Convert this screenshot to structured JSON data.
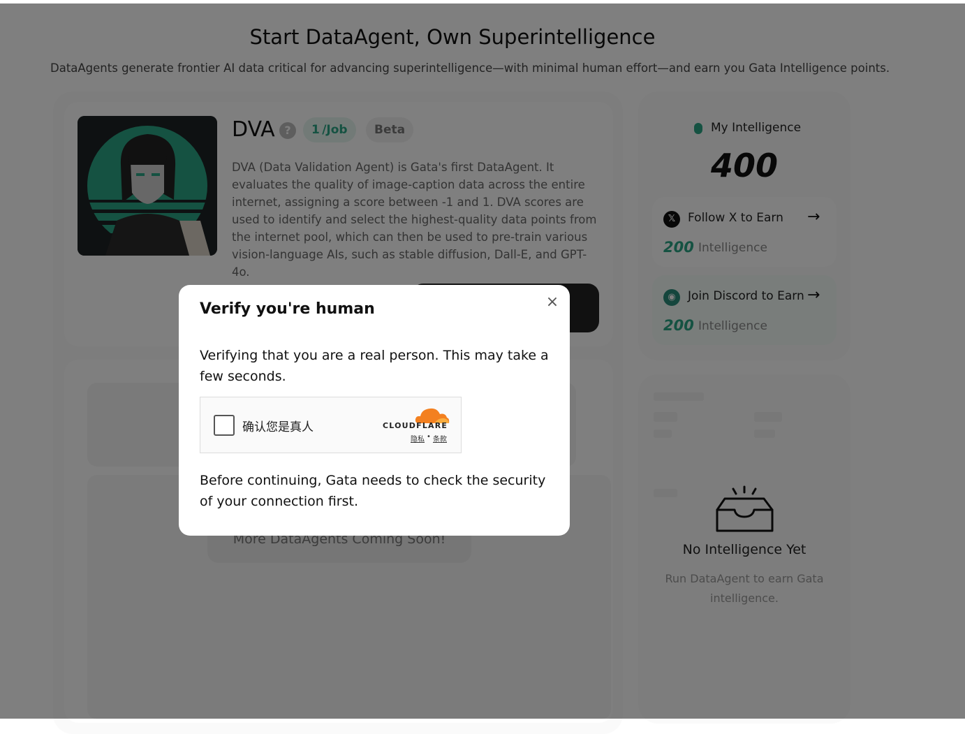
{
  "header": {
    "title": "Start DataAgent, Own Superintelligence",
    "subtitle": "DataAgents generate frontier AI data critical for advancing superintelligence—with minimal human effort—and earn you Gata Intelligence points."
  },
  "agent": {
    "name": "DVA",
    "help_glyph": "?",
    "rate": "1 /Job",
    "badge": "Beta",
    "description": "DVA (Data Validation Agent) is Gata's first DataAgent. It evaluates the quality of image-caption data across the entire internet, assigning a score between -1 and 1. DVA scores are used to identify and select the highest-quality data points from the internet pool, which can then be used to pre-train various vision-language AIs, such as stable diffusion, Dall-E, and GPT-4o."
  },
  "more_agents": {
    "label": "More DataAgents Coming Soon!"
  },
  "intelligence": {
    "label": "My Intelligence",
    "value": "400",
    "tasks": [
      {
        "label": "Follow X to Earn",
        "amount": "200",
        "unit": "Intelligence",
        "icon": "x-logo-icon"
      },
      {
        "label": "Join Discord to Earn",
        "amount": "200",
        "unit": "Intelligence",
        "icon": "discord-logo-icon"
      }
    ]
  },
  "history": {
    "empty_title": "No Intelligence Yet",
    "empty_desc": "Run DataAgent to earn Gata intelligence."
  },
  "modal": {
    "title": "Verify you're human",
    "body": "Verifying that you are a real person. This may take a few seconds.",
    "footer": "Before continuing, Gata needs to check the security of your connection first.",
    "close_glyph": "×",
    "turnstile": {
      "label": "确认您是真人",
      "brand": "CLOUDFLARE",
      "privacy": "隐私",
      "separator": "•",
      "terms": "条款"
    }
  },
  "colors": {
    "accent": "#2aa584",
    "overlay": "rgba(0,0,0,0.5)",
    "cloudflare_orange": "#f38020"
  }
}
